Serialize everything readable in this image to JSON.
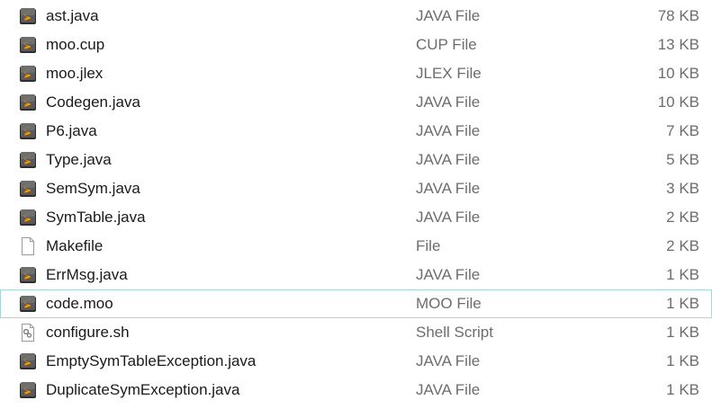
{
  "files": [
    {
      "name": "ast.java",
      "type": "JAVA File",
      "size": "78 KB",
      "icon": "sublime-text-icon"
    },
    {
      "name": "moo.cup",
      "type": "CUP File",
      "size": "13 KB",
      "icon": "sublime-text-icon"
    },
    {
      "name": "moo.jlex",
      "type": "JLEX File",
      "size": "10 KB",
      "icon": "sublime-text-icon"
    },
    {
      "name": "Codegen.java",
      "type": "JAVA File",
      "size": "10 KB",
      "icon": "sublime-text-icon"
    },
    {
      "name": "P6.java",
      "type": "JAVA File",
      "size": "7 KB",
      "icon": "sublime-text-icon"
    },
    {
      "name": "Type.java",
      "type": "JAVA File",
      "size": "5 KB",
      "icon": "sublime-text-icon"
    },
    {
      "name": "SemSym.java",
      "type": "JAVA File",
      "size": "3 KB",
      "icon": "sublime-text-icon"
    },
    {
      "name": "SymTable.java",
      "type": "JAVA File",
      "size": "2 KB",
      "icon": "sublime-text-icon"
    },
    {
      "name": "Makefile",
      "type": "File",
      "size": "2 KB",
      "icon": "blank-file-icon"
    },
    {
      "name": "ErrMsg.java",
      "type": "JAVA File",
      "size": "1 KB",
      "icon": "sublime-text-icon"
    },
    {
      "name": "code.moo",
      "type": "MOO File",
      "size": "1 KB",
      "icon": "sublime-text-icon",
      "hovered": true
    },
    {
      "name": "configure.sh",
      "type": "Shell Script",
      "size": "1 KB",
      "icon": "shell-script-icon"
    },
    {
      "name": "EmptySymTableException.java",
      "type": "JAVA File",
      "size": "1 KB",
      "icon": "sublime-text-icon"
    },
    {
      "name": "DuplicateSymException.java",
      "type": "JAVA File",
      "size": "1 KB",
      "icon": "sublime-text-icon"
    }
  ],
  "colors": {
    "name_text": "#1a1a1a",
    "secondary_text": "#6d6d6d",
    "hover_border": "#a9d6dd",
    "sublime_bg": "#4a4a4a",
    "sublime_accent": "#ff9800"
  }
}
